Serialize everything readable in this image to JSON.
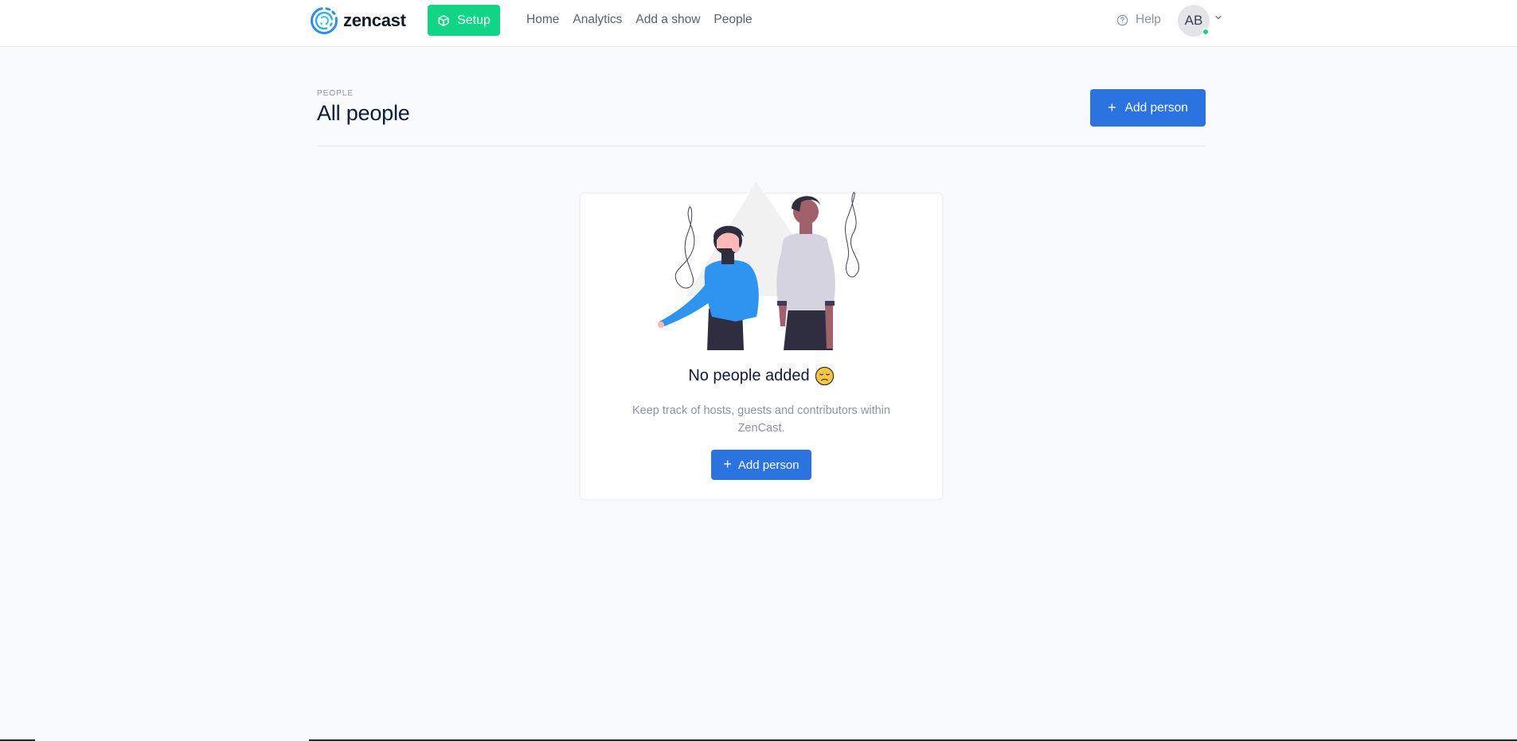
{
  "brand": {
    "name": "zencast",
    "accent_color": "#2b73df",
    "success_color": "#10d585"
  },
  "header": {
    "setup_label": "Setup",
    "nav": [
      {
        "label": "Home"
      },
      {
        "label": "Analytics"
      },
      {
        "label": "Add a show"
      },
      {
        "label": "People"
      }
    ],
    "help_label": "Help",
    "avatar_initials": "AB",
    "icons": {
      "setup": "box-icon",
      "help": "question-circle-icon",
      "avatar_menu": "chevron-down-icon",
      "status": "online-dot"
    }
  },
  "page": {
    "eyebrow": "PEOPLE",
    "title": "All people",
    "add_button_label": "Add person"
  },
  "empty_state": {
    "title": "No people added",
    "emoji": "disappointed-face",
    "description": "Keep track of hosts, guests and contributors within ZenCast.",
    "button_label": "Add person",
    "illustration": "two-people-illustration"
  }
}
